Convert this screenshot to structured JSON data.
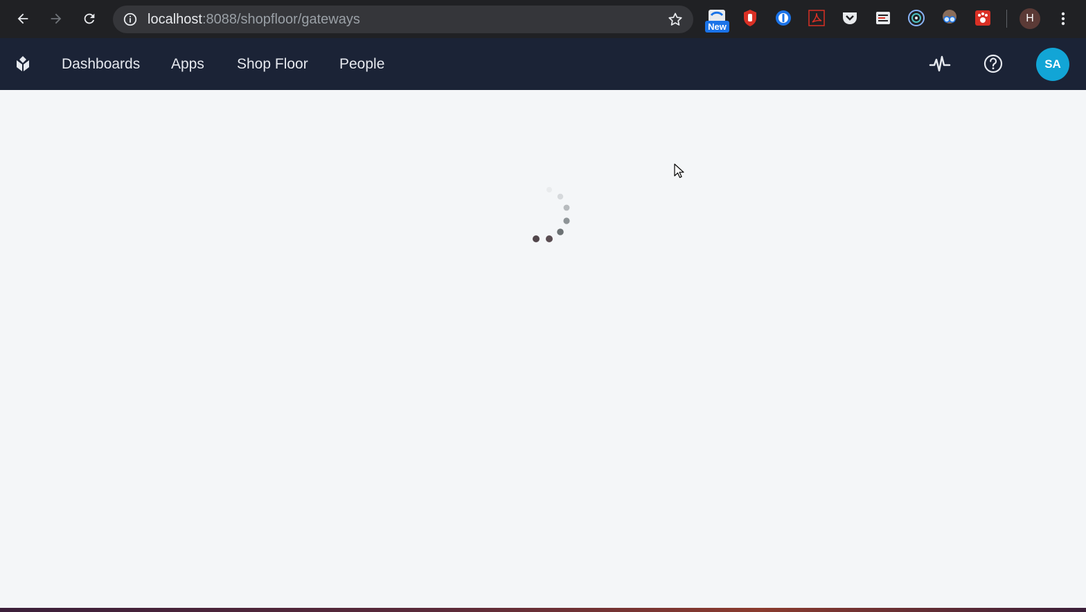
{
  "browser": {
    "url_host": "localhost",
    "url_path": ":8088/shopfloor/gateways",
    "new_badge": "New",
    "profile_initial": "H",
    "icons": [
      "back-arrow-icon",
      "forward-arrow-icon",
      "reload-icon",
      "info-icon",
      "star-icon"
    ]
  },
  "app": {
    "nav": {
      "dashboards": "Dashboards",
      "apps": "Apps",
      "shop_floor": "Shop Floor",
      "people": "People"
    },
    "user_initials": "SA",
    "colors": {
      "header_bg": "#1b2336",
      "avatar_bg": "#12a5d6",
      "page_bg": "#f4f6f8"
    }
  },
  "main": {
    "state": "loading"
  }
}
